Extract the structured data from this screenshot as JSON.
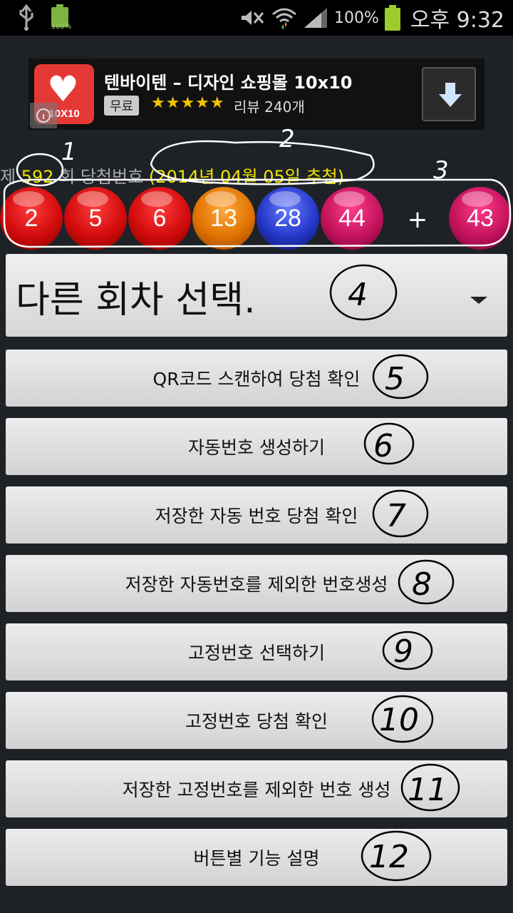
{
  "status_bar": {
    "small_battery_text": "100%",
    "battery_pct": "100%",
    "time": "오후 9:32"
  },
  "ad": {
    "logo_text": "10X10",
    "title": "텐바이텐 – 디자인 쇼핑몰 10x10",
    "price_badge": "무료",
    "stars": "★★★★★",
    "review": "리뷰 240개"
  },
  "draw": {
    "prefix": "제",
    "round": "592",
    "middle": "회 당첨번호",
    "date": "(2014년 04월 05일 추첨)"
  },
  "balls": [
    {
      "value": "2",
      "color": "red"
    },
    {
      "value": "5",
      "color": "red"
    },
    {
      "value": "6",
      "color": "red"
    },
    {
      "value": "13",
      "color": "orange"
    },
    {
      "value": "28",
      "color": "blue"
    },
    {
      "value": "44",
      "color": "magenta"
    }
  ],
  "plus": "+",
  "bonus_ball": {
    "value": "43",
    "color": "magenta"
  },
  "round_select": {
    "label": "다른 회차 선택."
  },
  "buttons": [
    {
      "label": "QR코드 스캔하여 당첨 확인"
    },
    {
      "label": "자동번호 생성하기"
    },
    {
      "label": "저장한 자동 번호 당첨 확인"
    },
    {
      "label": "저장한 자동번호를 제외한 번호생성"
    },
    {
      "label": "고정번호 선택하기"
    },
    {
      "label": "고정번호 당첨 확인"
    },
    {
      "label": "저장한 고정번호를 제외한 번호 생성"
    },
    {
      "label": "버튼별 기능 설명"
    }
  ],
  "annotations": [
    "1",
    "2",
    "3",
    "4",
    "5",
    "6",
    "7",
    "8",
    "9",
    "10",
    "11",
    "12"
  ],
  "colors": {
    "background": "#1e2226",
    "highlight_text": "#f2e600",
    "button_face": "#e0e0e0"
  }
}
